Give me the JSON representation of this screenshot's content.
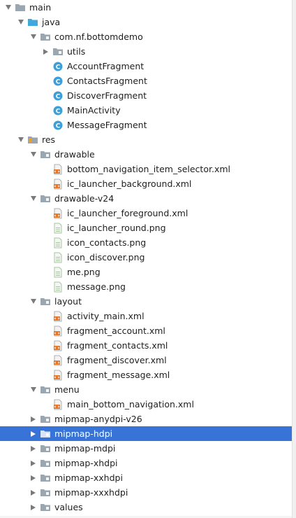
{
  "tree": [
    {
      "label": "main",
      "level": 0,
      "icon": "folder-icon",
      "arrow": "down"
    },
    {
      "label": "java",
      "level": 1,
      "icon": "source-folder-icon",
      "arrow": "down"
    },
    {
      "label": "com.nf.bottomdemo",
      "level": 2,
      "icon": "package-icon",
      "arrow": "down"
    },
    {
      "label": "utils",
      "level": 3,
      "icon": "package-icon",
      "arrow": "right"
    },
    {
      "label": "AccountFragment",
      "level": 3,
      "icon": "class-icon",
      "arrow": "none"
    },
    {
      "label": "ContactsFragment",
      "level": 3,
      "icon": "class-icon",
      "arrow": "none"
    },
    {
      "label": "DiscoverFragment",
      "level": 3,
      "icon": "class-icon",
      "arrow": "none"
    },
    {
      "label": "MainActivity",
      "level": 3,
      "icon": "class-icon",
      "arrow": "none"
    },
    {
      "label": "MessageFragment",
      "level": 3,
      "icon": "class-icon",
      "arrow": "none"
    },
    {
      "label": "res",
      "level": 1,
      "icon": "resource-folder-icon",
      "arrow": "down"
    },
    {
      "label": "drawable",
      "level": 2,
      "icon": "package-icon",
      "arrow": "down"
    },
    {
      "label": "bottom_navigation_item_selector.xml",
      "level": 3,
      "icon": "xml-file-icon",
      "arrow": "none"
    },
    {
      "label": "ic_launcher_background.xml",
      "level": 3,
      "icon": "xml-file-icon",
      "arrow": "none"
    },
    {
      "label": "drawable-v24",
      "level": 2,
      "icon": "package-icon",
      "arrow": "down"
    },
    {
      "label": "ic_launcher_foreground.xml",
      "level": 3,
      "icon": "xml-file-icon",
      "arrow": "none"
    },
    {
      "label": "ic_launcher_round.png",
      "level": 3,
      "icon": "image-file-icon",
      "arrow": "none"
    },
    {
      "label": "icon_contacts.png",
      "level": 3,
      "icon": "image-file-icon",
      "arrow": "none"
    },
    {
      "label": "icon_discover.png",
      "level": 3,
      "icon": "image-file-icon",
      "arrow": "none"
    },
    {
      "label": "me.png",
      "level": 3,
      "icon": "image-file-icon",
      "arrow": "none"
    },
    {
      "label": "message.png",
      "level": 3,
      "icon": "image-file-icon",
      "arrow": "none"
    },
    {
      "label": "layout",
      "level": 2,
      "icon": "package-icon",
      "arrow": "down"
    },
    {
      "label": "activity_main.xml",
      "level": 3,
      "icon": "xml-file-icon",
      "arrow": "none"
    },
    {
      "label": "fragment_account.xml",
      "level": 3,
      "icon": "xml-file-icon",
      "arrow": "none"
    },
    {
      "label": "fragment_contacts.xml",
      "level": 3,
      "icon": "xml-file-icon",
      "arrow": "none"
    },
    {
      "label": "fragment_discover.xml",
      "level": 3,
      "icon": "xml-file-icon",
      "arrow": "none"
    },
    {
      "label": "fragment_message.xml",
      "level": 3,
      "icon": "xml-file-icon",
      "arrow": "none"
    },
    {
      "label": "menu",
      "level": 2,
      "icon": "package-icon",
      "arrow": "down"
    },
    {
      "label": "main_bottom_navigation.xml",
      "level": 3,
      "icon": "xml-file-icon",
      "arrow": "none"
    },
    {
      "label": "mipmap-anydpi-v26",
      "level": 2,
      "icon": "package-icon",
      "arrow": "right"
    },
    {
      "label": "mipmap-hdpi",
      "level": 2,
      "icon": "package-icon",
      "arrow": "right",
      "selected": true
    },
    {
      "label": "mipmap-mdpi",
      "level": 2,
      "icon": "package-icon",
      "arrow": "right"
    },
    {
      "label": "mipmap-xhdpi",
      "level": 2,
      "icon": "package-icon",
      "arrow": "right"
    },
    {
      "label": "mipmap-xxhdpi",
      "level": 2,
      "icon": "package-icon",
      "arrow": "right"
    },
    {
      "label": "mipmap-xxxhdpi",
      "level": 2,
      "icon": "package-icon",
      "arrow": "right"
    },
    {
      "label": "values",
      "level": 2,
      "icon": "package-icon",
      "arrow": "right"
    }
  ],
  "colors": {
    "selection": "#3874d8",
    "folder": "#9aa7b0",
    "source_folder": "#3fa9dc",
    "class": "#3d9fd8",
    "xml_tag": "#e57a2c",
    "image_file": "#a7c4a0",
    "arrow": "#7a7a7a"
  }
}
